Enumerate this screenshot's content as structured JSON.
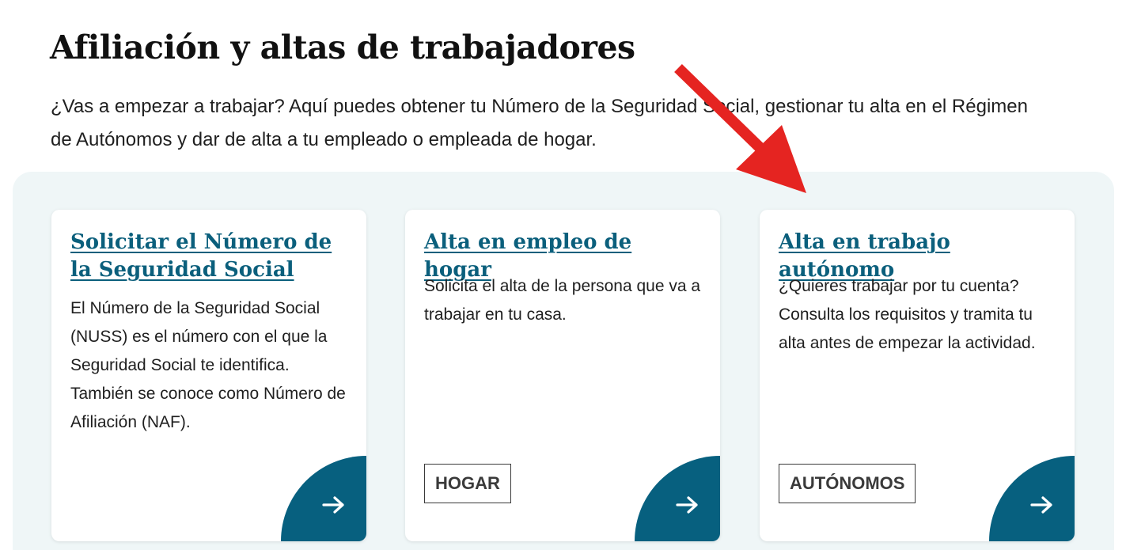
{
  "page": {
    "title": "Afiliación y altas de trabajadores",
    "intro": "¿Vas a empezar a trabajar? Aquí puedes obtener tu Número de la Seguridad Social, gestionar tu alta en el Régimen de Autónomos y dar de alta a tu empleado o empleada de hogar."
  },
  "cards": [
    {
      "title": "Solicitar el Número de la Seguridad Social",
      "description": "El Número de la Seguridad Social (NUSS) es el número con el que la Seguridad Social te identifica. También se conoce como Número de Afiliación (NAF).",
      "tag": "",
      "icon": "arrow-right-icon"
    },
    {
      "title": "Alta en empleo de hogar",
      "description": "Solicita el alta de la persona que va a trabajar en tu casa.",
      "tag": "HOGAR",
      "icon": "arrow-right-icon"
    },
    {
      "title": "Alta en trabajo autónomo",
      "description": "¿Quieres trabajar por tu cuenta? Consulta los requisitos y tramita tu alta antes de empezar la actividad.",
      "tag": "AUTÓNOMOS",
      "icon": "arrow-right-icon"
    }
  ],
  "colors": {
    "link": "#0b5f7c",
    "corner": "#07607f",
    "panel": "#eff6f7",
    "annotation": "#e52421"
  }
}
